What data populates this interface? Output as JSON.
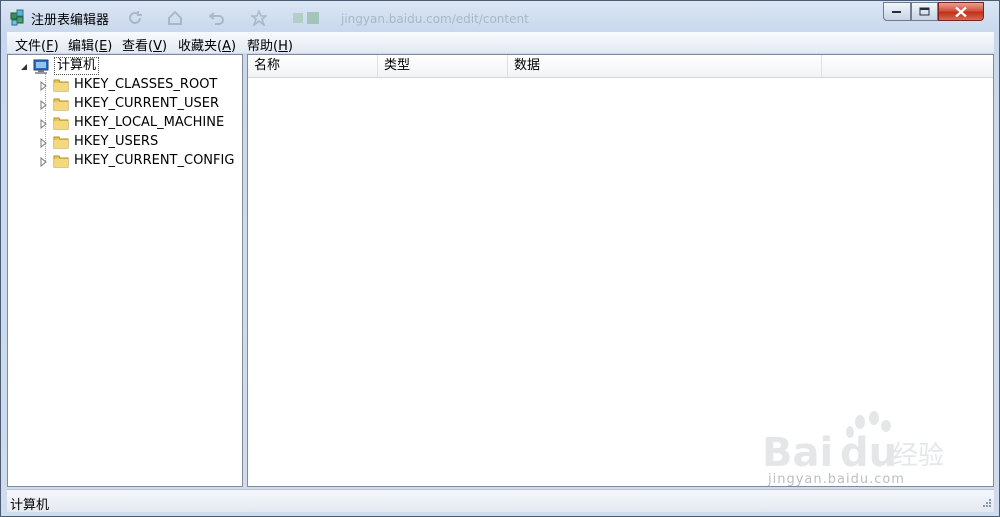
{
  "window": {
    "title": "注册表编辑器",
    "ghost_url": "jingyan.baidu.com/edit/content"
  },
  "menu": [
    {
      "label": "文件(",
      "key": "F",
      "tail": ")"
    },
    {
      "label": "编辑(",
      "key": "E",
      "tail": ")"
    },
    {
      "label": "查看(",
      "key": "V",
      "tail": ")"
    },
    {
      "label": "收藏夹(",
      "key": "A",
      "tail": ")"
    },
    {
      "label": "帮助(",
      "key": "H",
      "tail": ")"
    }
  ],
  "tree": {
    "root": "计算机",
    "children": [
      "HKEY_CLASSES_ROOT",
      "HKEY_CURRENT_USER",
      "HKEY_LOCAL_MACHINE",
      "HKEY_USERS",
      "HKEY_CURRENT_CONFIG"
    ]
  },
  "list": {
    "columns": [
      "名称",
      "类型",
      "数据"
    ]
  },
  "status": {
    "path": "计算机"
  },
  "watermark": {
    "brand": "Bai",
    "brand2": "du",
    "suffix": "经验",
    "url": "jingyan.baidu.com"
  },
  "colors": {
    "folder": "#e8c55a",
    "close": "#c2301b"
  }
}
